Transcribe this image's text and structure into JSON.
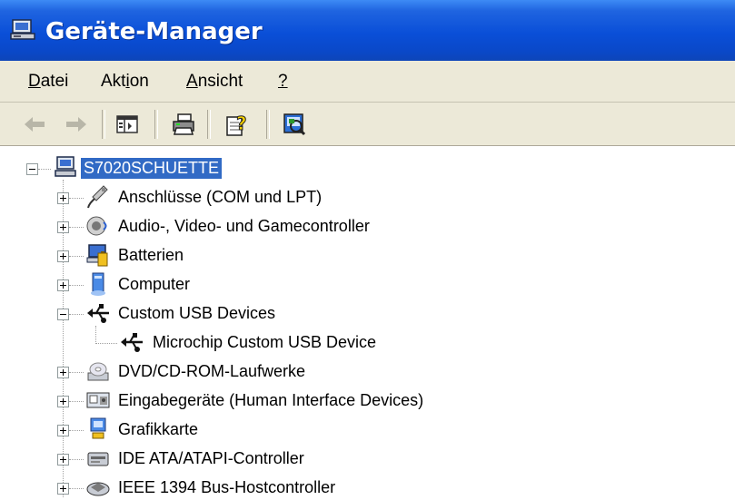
{
  "window": {
    "title": "Geräte-Manager"
  },
  "menu": {
    "items": [
      {
        "pre": "",
        "ul": "D",
        "post": "atei"
      },
      {
        "pre": "Akt",
        "ul": "i",
        "post": "on"
      },
      {
        "pre": "",
        "ul": "A",
        "post": "nsicht"
      },
      {
        "pre": "",
        "ul": "?",
        "post": ""
      }
    ]
  },
  "toolbar": {
    "buttons": [
      "back-icon",
      "forward-icon",
      "show-hide-console-tree-icon",
      "print-icon",
      "help-icon",
      "scan-hardware-icon"
    ]
  },
  "tree": {
    "root": {
      "label": "S7020SCHUETTE",
      "icon": "computer-icon",
      "selected": true
    },
    "items": [
      {
        "label": "Anschlüsse (COM und LPT)",
        "icon": "port-icon",
        "expanded": false
      },
      {
        "label": "Audio-, Video- und Gamecontroller",
        "icon": "audio-icon",
        "expanded": false
      },
      {
        "label": "Batterien",
        "icon": "battery-icon",
        "expanded": false
      },
      {
        "label": "Computer",
        "icon": "computer-node-icon",
        "expanded": false
      },
      {
        "label": "Custom USB Devices",
        "icon": "usb-icon",
        "expanded": true
      },
      {
        "label": "Microchip Custom USB Device",
        "icon": "usb-icon",
        "child": true
      },
      {
        "label": "DVD/CD-ROM-Laufwerke",
        "icon": "dvd-icon",
        "expanded": false
      },
      {
        "label": "Eingabegeräte (Human Interface Devices)",
        "icon": "hid-icon",
        "expanded": false
      },
      {
        "label": "Grafikkarte",
        "icon": "display-adapter-icon",
        "expanded": false
      },
      {
        "label": "IDE ATA/ATAPI-Controller",
        "icon": "ide-icon",
        "expanded": false
      },
      {
        "label": "IEEE 1394 Bus-Hostcontroller",
        "icon": "ieee1394-icon",
        "expanded": false
      }
    ]
  },
  "colors": {
    "title_bar": "#0a4fd8",
    "selection": "#316ac5",
    "chrome": "#ece9d8"
  }
}
